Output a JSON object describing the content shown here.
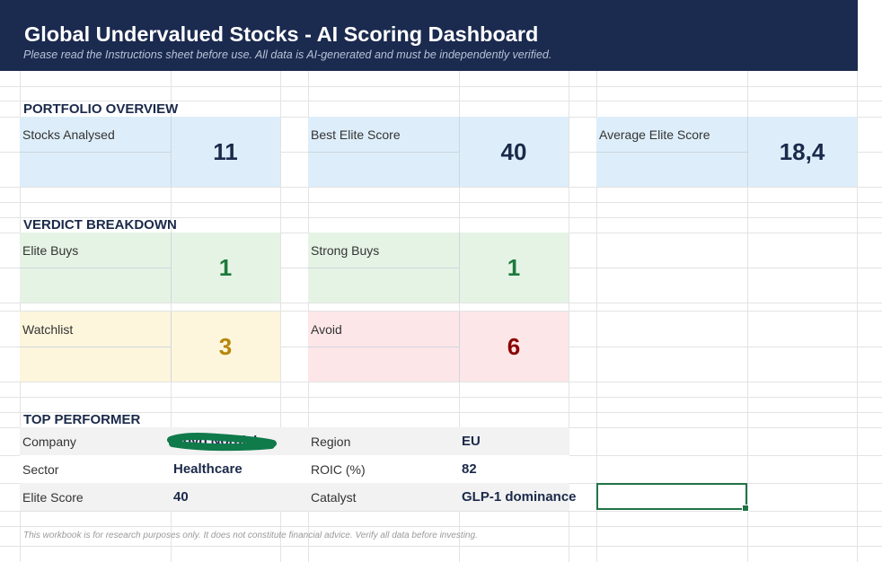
{
  "header": {
    "title": "Global Undervalued Stocks - AI Scoring Dashboard",
    "subtitle": "Please read the Instructions sheet before use. All data is AI-generated and must be independently verified."
  },
  "portfolio_overview": {
    "heading": "PORTFOLIO OVERVIEW",
    "stocks_analysed": {
      "label": "Stocks Analysed",
      "value": "11"
    },
    "best_elite_score": {
      "label": "Best Elite Score",
      "value": "40"
    },
    "average_elite_score": {
      "label": "Average Elite Score",
      "value": "18,4"
    }
  },
  "verdict_breakdown": {
    "heading": "VERDICT BREAKDOWN",
    "elite_buys": {
      "label": "Elite Buys",
      "value": "1",
      "color": "#1e7a3c"
    },
    "strong_buys": {
      "label": "Strong Buys",
      "value": "1",
      "color": "#1e7a3c"
    },
    "watchlist": {
      "label": "Watchlist",
      "value": "3",
      "color": "#b8860b"
    },
    "avoid": {
      "label": "Avoid",
      "value": "6",
      "color": "#8b0000"
    }
  },
  "top_performer": {
    "heading": "TOP PERFORMER",
    "rows": [
      {
        "k1": "Company",
        "v1": "Novo Nordisk",
        "k2": "Region",
        "v2": "EU"
      },
      {
        "k1": "Sector",
        "v1": "Healthcare",
        "k2": "ROIC (%)",
        "v2": "82"
      },
      {
        "k1": "Elite Score",
        "v1": "40",
        "k2": "Catalyst",
        "v2": "GLP-1 dominance"
      }
    ]
  },
  "footer": "This workbook is for research purposes only. It does not constitute financial advice. Verify all data before investing.",
  "colors": {
    "banner": "#1b2a4f",
    "excel_green": "#217346",
    "redaction": "#0f7a4a"
  }
}
